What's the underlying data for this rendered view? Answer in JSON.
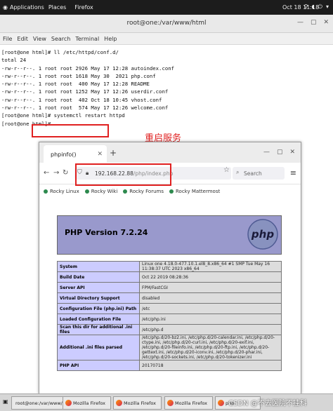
{
  "topbar": {
    "applications": "Applications",
    "places": "Places",
    "firefox": "Firefox",
    "clock": "Oct 18  11:18"
  },
  "terminal": {
    "title": "root@one:/var/www/html",
    "menu": [
      "File",
      "Edit",
      "View",
      "Search",
      "Terminal",
      "Help"
    ],
    "lines": [
      "[root@one html]# ll /etc/httpd/conf.d/",
      "total 24",
      "-rw-r--r--. 1 root root 2926 May 17 12:28 autoindex.conf",
      "-rw-r--r--. 1 root root 1618 May 30  2021 php.conf",
      "-rw-r--r--. 1 root root  400 May 17 12:28 README",
      "-rw-r--r--. 1 root root 1252 May 17 12:26 userdir.conf",
      "-rw-r--r--. 1 root root  402 Oct 18 10:45 vhost.conf",
      "-rw-r--r--. 1 root root  574 May 17 12:26 welcome.conf",
      "[root@one html]# systemctl restart httpd",
      "[root@one html]# "
    ]
  },
  "annotation": {
    "text": "重启服务",
    "color": "#e02020"
  },
  "firefox": {
    "tab_title": "phpinfo()",
    "url_host": "192.168.22.88",
    "url_path": "/php/index.php",
    "search_placeholder": "Search",
    "bookmarks": [
      "Rocky Linux",
      "Rocky Wiki",
      "Rocky Forums",
      "Rocky Mattermost"
    ]
  },
  "phpinfo": {
    "version": "PHP Version 7.2.24",
    "logo_text": "php",
    "header_color": "#9999cc",
    "rows": [
      {
        "k": "System",
        "v": "Linux one 4.18.0-477.10.1.el8_8.x86_64 #1 SMP Tue May 16 11:38:37 UTC 2023 x86_64"
      },
      {
        "k": "Build Date",
        "v": "Oct 22 2019 08:28:36"
      },
      {
        "k": "Server API",
        "v": "FPM/FastCGI"
      },
      {
        "k": "Virtual Directory Support",
        "v": "disabled"
      },
      {
        "k": "Configuration File (php.ini) Path",
        "v": "/etc"
      },
      {
        "k": "Loaded Configuration File",
        "v": "/etc/php.ini"
      },
      {
        "k": "Scan this dir for additional .ini files",
        "v": "/etc/php.d"
      },
      {
        "k": "Additional .ini files parsed",
        "v": "/etc/php.d/20-bz2.ini, /etc/php.d/20-calendar.ini, /etc/php.d/20-ctype.ini, /etc/php.d/20-curl.ini, /etc/php.d/20-exif.ini, /etc/php.d/20-fileinfo.ini, /etc/php.d/20-ftp.ini, /etc/php.d/20-gettext.ini, /etc/php.d/20-iconv.ini, /etc/php.d/20-phar.ini, /etc/php.d/20-sockets.ini, /etc/php.d/20-tokenizer.ini"
      },
      {
        "k": "PHP API",
        "v": "20170718"
      }
    ]
  },
  "taskbar": {
    "items": [
      "root@one:/var/www/html",
      "Mozilla Firefox",
      "Mozilla Firefox",
      "Mozilla Firefox",
      "php"
    ],
    "watermark": "CSDN @不去医院不挂科"
  }
}
